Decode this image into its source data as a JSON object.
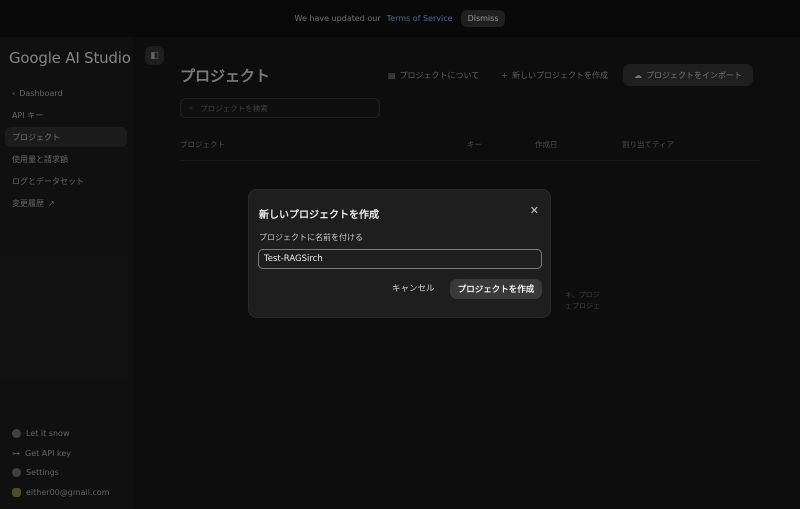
{
  "banner": {
    "text": "We have updated our",
    "link": "Terms of Service",
    "dismiss": "Dismiss"
  },
  "sidebar": {
    "logo": "Google AI Studio",
    "items": [
      {
        "label": "Dashboard",
        "icon": "chevron-left-icon"
      },
      {
        "label": "API キー"
      },
      {
        "label": "プロジェクト",
        "active": true
      },
      {
        "label": "使用量と請求額"
      },
      {
        "label": "ログとデータセット"
      },
      {
        "label": "変更履歴",
        "icon": "external-link-icon"
      }
    ],
    "bottom": [
      {
        "label": "Let it snow",
        "icon": "snowflake-icon"
      },
      {
        "label": "Get API key",
        "icon": "key-icon"
      },
      {
        "label": "Settings",
        "icon": "gear-icon"
      },
      {
        "label": "either00@gmail.com",
        "icon": "avatar-icon"
      }
    ]
  },
  "main": {
    "title": "プロジェクト",
    "actions": {
      "about": "プロジェクトについて",
      "create": "新しいプロジェクトを作成",
      "import": "プロジェクトをインポート"
    },
    "search_placeholder": "プロジェクトを検索",
    "table": {
      "headers": [
        "プロジェクト",
        "キー",
        "作成日",
        "割り当てティア"
      ]
    },
    "empty_text_line1": "キ、プロジ",
    "empty_text_line2": "ェプロジェ"
  },
  "modal": {
    "title": "新しいプロジェクトを作成",
    "label": "プロジェクトに名前を付ける",
    "input_value": "Test-RAGSirch",
    "cancel": "キャンセル",
    "create": "プロジェクトを作成"
  }
}
